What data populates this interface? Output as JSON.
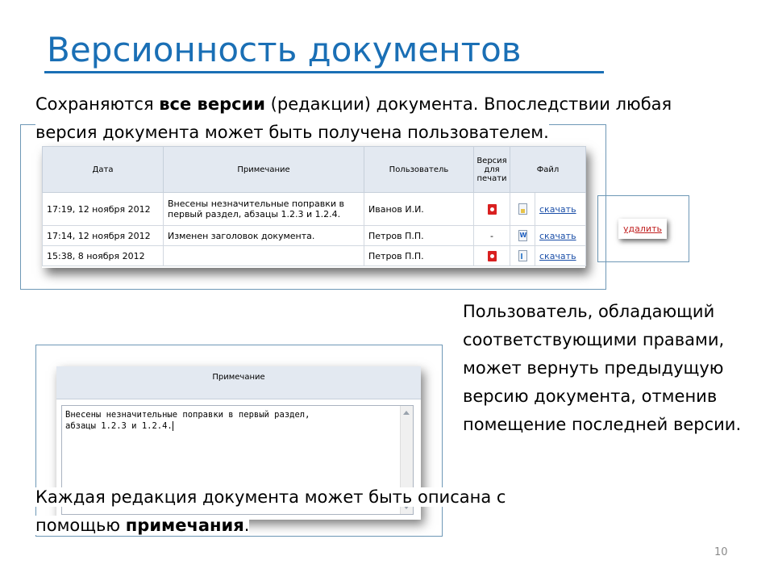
{
  "slide": {
    "title": "Версионность документов",
    "intro": {
      "part1": "Сохраняются ",
      "bold": "все версии",
      "part2": " (редакции) документа. Впоследствии любая",
      "line2": "версия документа может быть получена пользователем."
    },
    "rights_text": "Пользователь, обладающий соответствующими правами, может вернуть предыдущую версию документа, отменив помещение последней версии.",
    "note_text": {
      "part1": "Каждая редакция документа может быть описана с",
      "part2": "помощью ",
      "bold": "примечания",
      "part3": "."
    },
    "page_number": "10"
  },
  "versions_table": {
    "headers": {
      "date": "Дата",
      "note": "Примечание",
      "user": "Пользователь",
      "print": "Версия для печати",
      "file": "Файл"
    },
    "rows": [
      {
        "date": "17:19, 12 ноября 2012",
        "note": "Внесены незначительные поправки в первый раздел, абзацы 1.2.3 и 1.2.4.",
        "user": "Иванов И.И.",
        "print_icon": "pdf-icon",
        "print_text": "",
        "file_icon": "file-icon",
        "download": "скачать"
      },
      {
        "date": "17:14, 12 ноября 2012",
        "note": "Изменен заголовок документа.",
        "user": "Петров П.П.",
        "print_icon": "",
        "print_text": "-",
        "file_icon": "word-file-icon",
        "download": "скачать"
      },
      {
        "date": "15:38, 8 ноября 2012",
        "note": "",
        "user": "Петров П.П.",
        "print_icon": "pdf-icon",
        "print_text": "",
        "file_icon": "doc-file-icon",
        "download": "скачать"
      }
    ]
  },
  "delete_button": {
    "label": "удалить"
  },
  "note_editor": {
    "header": "Примечание",
    "value": "Внесены незначительные поправки в первый раздел,\nабзацы 1.2.3 и 1.2.4."
  },
  "colors": {
    "title": "#1a6fb5",
    "frame": "#6e98b6",
    "table_header": "#e3e9f1",
    "link": "#1b4fa8",
    "delete_link": "#c02020"
  }
}
